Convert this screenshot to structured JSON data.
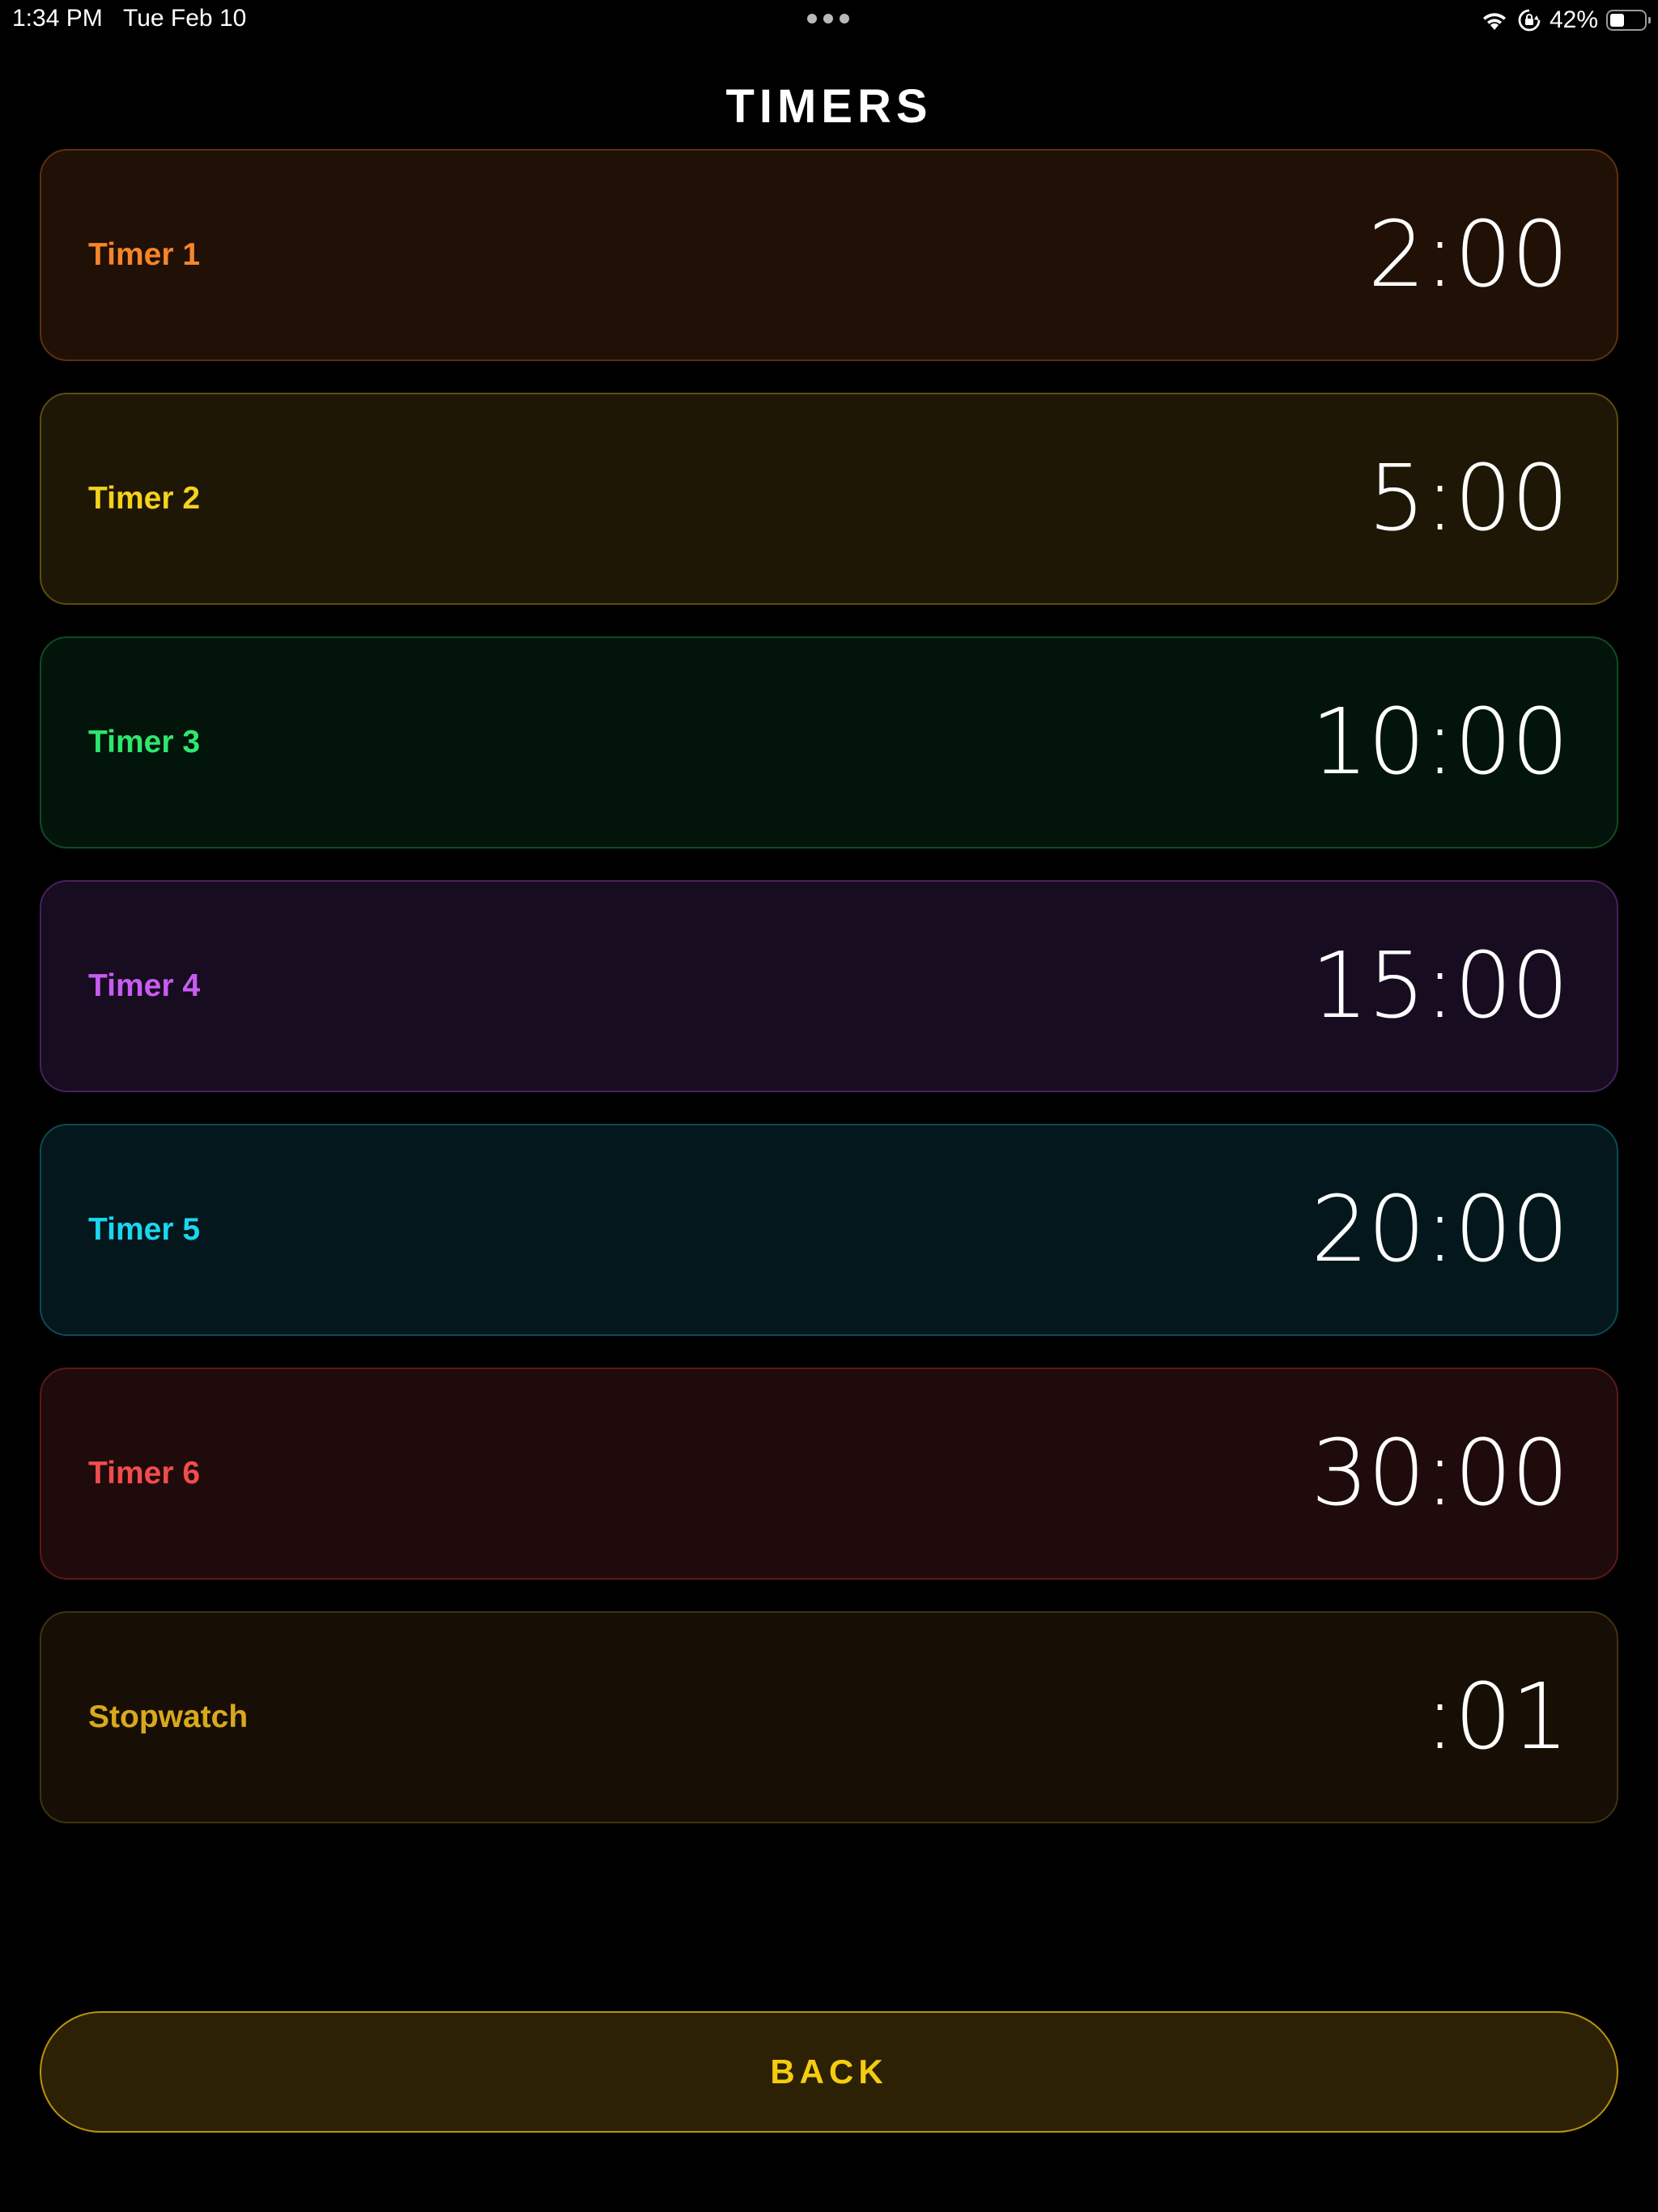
{
  "status_bar": {
    "time": "1:34 PM",
    "date": "Tue Feb 10",
    "battery_percent": "42%",
    "battery_level": 0.42,
    "icons": [
      "multitasking-dots-icon",
      "wifi-icon",
      "orientation-lock-icon",
      "battery-icon"
    ]
  },
  "title": "TIMERS",
  "timers": [
    {
      "label": "Timer 1",
      "value": "2:00",
      "accent": "#f5862a",
      "bg": "#211006",
      "border": "#5e3010"
    },
    {
      "label": "Timer 2",
      "value": "5:00",
      "accent": "#f5d21c",
      "bg": "#1e1706",
      "border": "#5e4b10"
    },
    {
      "label": "Timer 3",
      "value": "10:00",
      "accent": "#2ee86e",
      "bg": "#03150a",
      "border": "#0f4a24"
    },
    {
      "label": "Timer 4",
      "value": "15:00",
      "accent": "#c85cf2",
      "bg": "#170c20",
      "border": "#46215e"
    },
    {
      "label": "Timer 5",
      "value": "20:00",
      "accent": "#1ad7ef",
      "bg": "#03171c",
      "border": "#0c4a56"
    },
    {
      "label": "Timer 6",
      "value": "30:00",
      "accent": "#f24c4c",
      "bg": "#1f0b0b",
      "border": "#5e1818"
    },
    {
      "label": "Stopwatch",
      "value": ":01",
      "accent": "#d9a91c",
      "bg": "#170f05",
      "border": "#3f3212"
    }
  ],
  "back_button": {
    "label": "BACK",
    "color": "#f5cc0f"
  }
}
